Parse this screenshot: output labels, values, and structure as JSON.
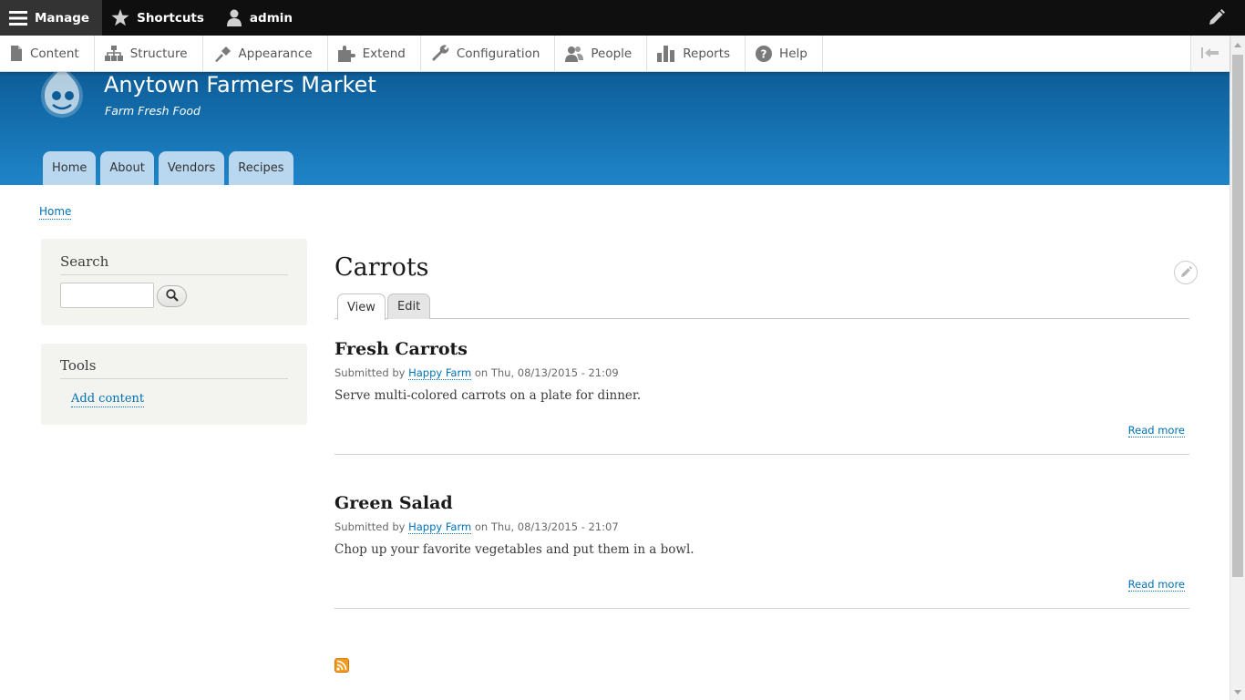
{
  "toolbar": {
    "manage_label": "Manage",
    "shortcuts_label": "Shortcuts",
    "user_label": "admin"
  },
  "tray": {
    "items": [
      {
        "label": "Content",
        "icon": "file-icon"
      },
      {
        "label": "Structure",
        "icon": "sitemap-icon"
      },
      {
        "label": "Appearance",
        "icon": "paintbrush-icon"
      },
      {
        "label": "Extend",
        "icon": "puzzle-icon"
      },
      {
        "label": "Configuration",
        "icon": "wrench-icon"
      },
      {
        "label": "People",
        "icon": "people-icon"
      },
      {
        "label": "Reports",
        "icon": "bar-chart-icon"
      },
      {
        "label": "Help",
        "icon": "help-icon"
      }
    ]
  },
  "site": {
    "name": "Anytown Farmers Market",
    "slogan": "Farm Fresh Food",
    "brand_color_top": "#0d5d98",
    "brand_color_bottom": "#1e85c9"
  },
  "main_menu": [
    "Home",
    "About",
    "Vendors",
    "Recipes"
  ],
  "breadcrumb": {
    "home": "Home"
  },
  "sidebar": {
    "search_title": "Search",
    "tools_title": "Tools",
    "add_content": "Add content"
  },
  "page": {
    "title": "Carrots",
    "tabs": {
      "view": "View",
      "edit": "Edit"
    }
  },
  "teasers": [
    {
      "title": "Fresh Carrots",
      "submitted_by": "Submitted by",
      "author": "Happy Farm",
      "date": "on Thu, 08/13/2015 - 21:09",
      "body": "Serve multi-colored carrots on a plate for dinner.",
      "read_more": "Read more"
    },
    {
      "title": "Green Salad",
      "submitted_by": "Submitted by",
      "author": "Happy Farm",
      "date": "on Thu, 08/13/2015 - 21:07",
      "body": "Chop up your favorite vegetables and put them in a bowl.",
      "read_more": "Read more"
    }
  ]
}
